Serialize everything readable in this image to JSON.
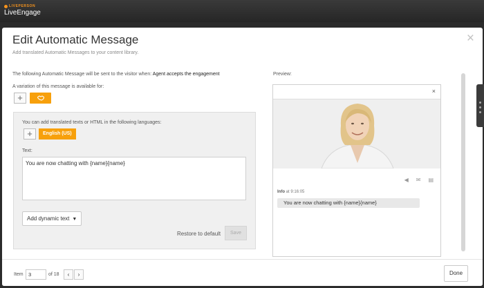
{
  "app": {
    "brand_small": "LIVEPERSON",
    "brand_name": "LiveEngage"
  },
  "modal": {
    "title": "Edit Automatic Message",
    "subtitle": "Add translated Automatic Messages to your content library.",
    "sent_prefix": "The following Automatic Message will be sent to the visitor when:",
    "sent_trigger": "Agent accepts the engagement",
    "variation_label": "A variation of this message is available for:",
    "close_icon": "close-icon"
  },
  "translations": {
    "lang_label": "You can add translated texts or HTML in the following languages:",
    "language": "English (US)",
    "text_label": "Text:",
    "text_value": "You are now chatting with {name}{name}",
    "dynamic_text_label": "Add dynamic text",
    "restore_label": "Restore to default",
    "save_label": "Save"
  },
  "preview": {
    "label": "Preview:",
    "info_name": "Info",
    "info_time": "at 9:16:05",
    "message": "You are now chatting with {name}{name}",
    "icons": [
      "speaker-icon",
      "email-icon",
      "print-icon"
    ]
  },
  "footer": {
    "item_label": "Item",
    "item_value": "3",
    "of_label": "of 18",
    "done_label": "Done"
  },
  "colors": {
    "accent": "#f7a00c",
    "brand_orange": "#f7941d",
    "topbar": "#2b2b2b"
  }
}
